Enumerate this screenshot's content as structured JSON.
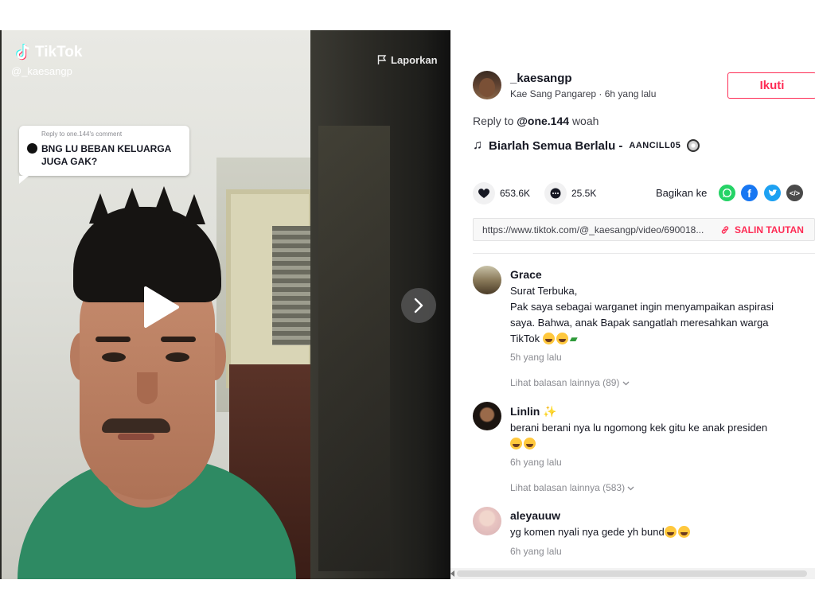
{
  "video": {
    "brand": "TikTok",
    "username": "@_kaesangp",
    "report_label": "Laporkan",
    "reply_bubble": {
      "reply_to": "Reply to one.144's comment",
      "text": "BNG LU BEBAN KELUARGA JUGA GAK?"
    },
    "icons": {
      "play": "play-icon",
      "next": "chevron-right-icon",
      "flag": "flag-icon"
    }
  },
  "author": {
    "username": "_kaesangp",
    "meta": "Kae Sang Pangarep · 6h yang lalu",
    "follow_label": "Ikuti"
  },
  "caption": {
    "prefix": "Reply to",
    "mention": "@one.144",
    "text": "woah"
  },
  "music": {
    "title": "Biarlah Semua Berlalu -",
    "artist": "AANCILL05"
  },
  "stats": {
    "likes": "653.6K",
    "comments": "25.5K"
  },
  "share": {
    "label": "Bagikan ke",
    "targets": [
      "whatsapp",
      "facebook",
      "twitter",
      "embed"
    ],
    "colors": {
      "whatsapp": "#25d366",
      "facebook": "#1877f2",
      "twitter": "#1da1f2",
      "embed": "#4a4a4a"
    }
  },
  "link": {
    "url": "https://www.tiktok.com/@_kaesangp/video/690018...",
    "copy_label": "SALIN TAUTAN"
  },
  "comments": [
    {
      "name": "Grace",
      "lines": [
        "Surat Terbuka,",
        "Pak saya sebagai warganet ingin menyampaikan aspirasi",
        "saya. Bahwa, anak Bapak sangatlah meresahkan warga",
        "TikTok"
      ],
      "time": "5h yang lalu",
      "more": "Lihat balasan lainnya (89)"
    },
    {
      "name": "Linlin",
      "lines": [
        "berani berani nya lu ngomong kek gitu ke anak presiden"
      ],
      "time": "6h yang lalu",
      "more": "Lihat balasan lainnya (583)"
    },
    {
      "name": "aleyauuw",
      "lines": [
        "yg komen nyali nya gede yh bund"
      ],
      "time": "6h yang lalu"
    }
  ],
  "colors": {
    "accent": "#fe2c55",
    "text": "#161823",
    "muted": "#8a8b91"
  }
}
